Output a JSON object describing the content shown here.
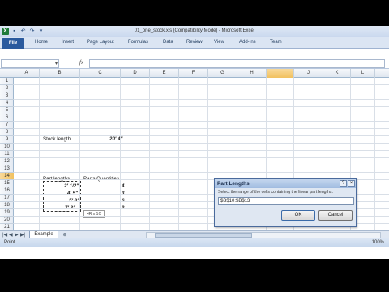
{
  "window": {
    "title": "01_one_stock.xls [Compatibility Mode] - Microsoft Excel",
    "app_icon": "X"
  },
  "ribbon": {
    "file_label": "File",
    "tabs": [
      "Home",
      "Insert",
      "Page Layout",
      "Formulas",
      "Data",
      "Review",
      "View",
      "Add-Ins",
      "Team"
    ]
  },
  "formula_bar": {
    "name_box": "",
    "fx_label": "fx",
    "value": ""
  },
  "grid": {
    "columns": [
      "A",
      "B",
      "C",
      "D",
      "E",
      "F",
      "G",
      "H",
      "I",
      "J",
      "K",
      "L"
    ],
    "rows": [
      "1",
      "2",
      "3",
      "4",
      "5",
      "6",
      "7",
      "8",
      "9",
      "10",
      "11",
      "12",
      "13",
      "14",
      "15",
      "16",
      "17",
      "18",
      "19",
      "20",
      "21"
    ],
    "active_column": "I",
    "active_row": "14"
  },
  "cells": {
    "stock_label": "Stock length",
    "stock_value": "20' 4\"",
    "part_lengths_header": "Part lengths",
    "quantities_header": "Parts Quantities",
    "parts": [
      {
        "length": "2' 1/2\"",
        "qty": "4"
      },
      {
        "length": "4' 5\"",
        "qty": "3"
      },
      {
        "length": "5' 8\"",
        "qty": "6"
      },
      {
        "length": "7' 3\"",
        "qty": "3"
      }
    ],
    "selection_tooltip": "4R x 1C"
  },
  "sheets": {
    "active": "Example",
    "nav": [
      "|◀",
      "◀",
      "▶",
      "▶|"
    ]
  },
  "status": {
    "text": "Point",
    "zoom": "100%"
  },
  "dialog": {
    "title": "Part Lengths",
    "help": "?",
    "close": "×",
    "prompt": "Select the range of the cells containing the linear part lengths.",
    "input_value": "$B$10:$B$13",
    "ok_label": "OK",
    "cancel_label": "Cancel"
  }
}
